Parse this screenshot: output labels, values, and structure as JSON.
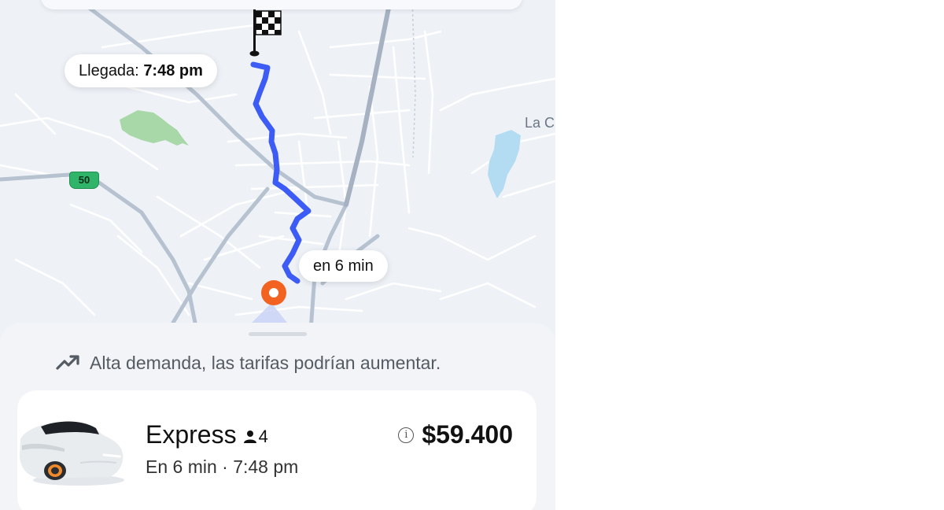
{
  "map": {
    "arrival_label": "Llegada:",
    "arrival_time": "7:48 pm",
    "pickup_eta": "en 6 min",
    "place_label": "La C",
    "route_shield": "50",
    "colors": {
      "route": "#3d5bf5",
      "pickup_pin": "#f26322",
      "park": "#a8d8a8",
      "water": "#b3dcf2",
      "roads": "#ffffff",
      "highway": "#b7c2d0"
    },
    "icons": {
      "destination": "checkered-flag-icon",
      "pickup": "pickup-pin-icon"
    }
  },
  "sheet": {
    "surge_icon": "trending-up-icon",
    "surge_text": "Alta demanda, las tarifas podrían aumentar.",
    "ride": {
      "name": "Express",
      "seat_icon": "person-icon",
      "seats": "4",
      "subtitle": "En 6 min · 7:48 pm",
      "price": "$59.400",
      "info_icon": "info-icon"
    }
  }
}
